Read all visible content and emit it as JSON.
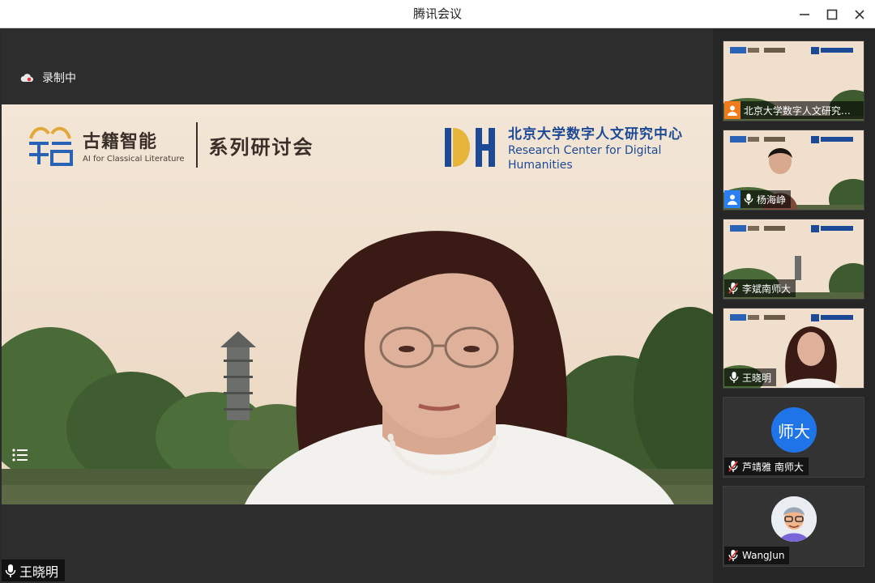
{
  "window": {
    "title": "腾讯会议"
  },
  "recording": {
    "label": "录制中"
  },
  "banner": {
    "brand_cn": "古籍智能",
    "brand_en": "AI for Classical Literature",
    "series": "系列研讨会",
    "dh_cn": "北京大学数字人文研究中心",
    "dh_en_line1": "Research Center for Digital",
    "dh_en_line2": "Humanities"
  },
  "speaker": {
    "name": "王晓明"
  },
  "participants": [
    {
      "name": "北京大学数字人文研究中...",
      "icon": "user-icon",
      "mic": "none",
      "badge_color": "#f07b1c"
    },
    {
      "name": "杨海峥",
      "icon": "user-icon",
      "mic": "mic-icon",
      "badge_color": "#2a7ff2"
    },
    {
      "name": "李斌南师大",
      "icon": "",
      "mic": "mic-muted-icon"
    },
    {
      "name": "王晓明",
      "icon": "",
      "mic": "mic-icon"
    },
    {
      "name": "芦靖雅 南师大",
      "icon": "",
      "mic": "mic-muted-icon",
      "avatar_text": "师大"
    },
    {
      "name": "WangJun",
      "icon": "",
      "mic": "mic-muted-icon"
    }
  ],
  "colors": {
    "accent_blue": "#1f74e8",
    "dh_blue": "#1d4a96",
    "muted_red": "#e03a3a"
  }
}
